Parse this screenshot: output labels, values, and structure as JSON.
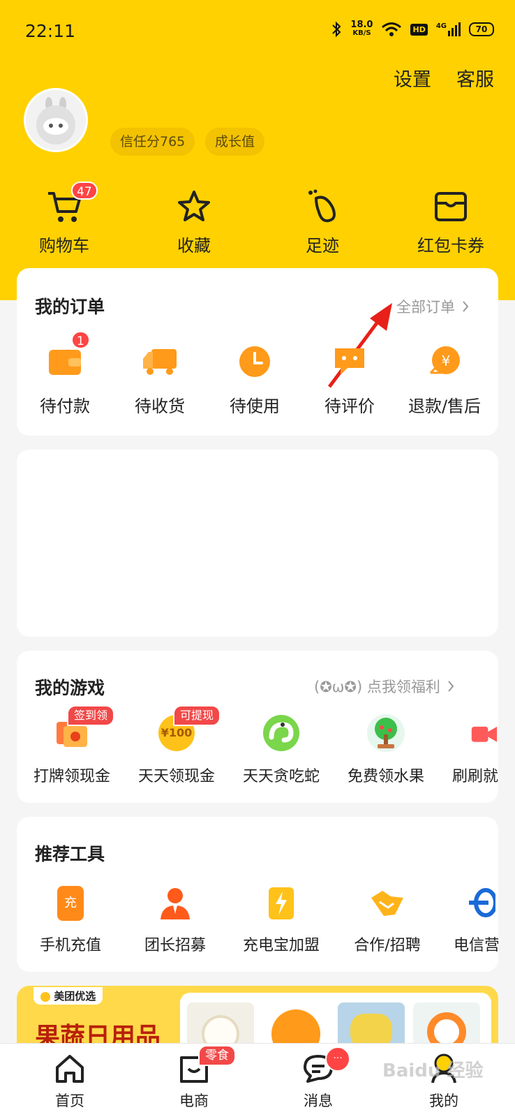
{
  "status_bar": {
    "time": "22:11",
    "net_speed": "18.0",
    "net_unit": "KB/S",
    "hd": "HD",
    "signal": "4G",
    "battery": "70"
  },
  "header": {
    "settings": "设置",
    "service": "客服"
  },
  "profile": {
    "trust_score": "信任分765",
    "growth": "成长值"
  },
  "quick_links": [
    {
      "label": "购物车",
      "icon": "cart-icon",
      "badge": "47"
    },
    {
      "label": "收藏",
      "icon": "star-icon"
    },
    {
      "label": "足迹",
      "icon": "footprint-icon"
    },
    {
      "label": "红包卡券",
      "icon": "wallet-icon"
    }
  ],
  "orders": {
    "title": "我的订单",
    "all_orders": "全部订单",
    "items": [
      {
        "label": "待付款",
        "icon": "wallet-icon",
        "badge": "1"
      },
      {
        "label": "待收货",
        "icon": "truck-icon"
      },
      {
        "label": "待使用",
        "icon": "clock-icon"
      },
      {
        "label": "待评价",
        "icon": "comment-icon"
      },
      {
        "label": "退款/售后",
        "icon": "refund-icon"
      }
    ]
  },
  "games": {
    "title": "我的游戏",
    "promo": "(✪ω✪) 点我领福利",
    "items": [
      {
        "label": "打牌领现金",
        "tag": "签到领"
      },
      {
        "label": "天天领现金",
        "tag": "可提现",
        "coin": "¥100"
      },
      {
        "label": "天天贪吃蛇"
      },
      {
        "label": "免费领水果"
      },
      {
        "label": "刷刷就"
      }
    ]
  },
  "tools": {
    "title": "推荐工具",
    "items": [
      {
        "label": "手机充值",
        "glyph": "充"
      },
      {
        "label": "团长招募"
      },
      {
        "label": "充电宝加盟"
      },
      {
        "label": "合作/招聘"
      },
      {
        "label": "电信营"
      }
    ]
  },
  "banner": {
    "brand": "美团优选",
    "headline": "果蔬日用品"
  },
  "bottom_nav": [
    {
      "label": "首页",
      "icon": "home-icon"
    },
    {
      "label": "电商",
      "icon": "shop-icon",
      "tag": "零食"
    },
    {
      "label": "消息",
      "icon": "message-icon",
      "tag": "···"
    },
    {
      "label": "我的",
      "icon": "profile-icon"
    }
  ],
  "watermark": "Baidu 经验",
  "colors": {
    "brand_yellow": "#ffd100",
    "accent_red": "#f44336",
    "orange": "#ff9a1a"
  }
}
